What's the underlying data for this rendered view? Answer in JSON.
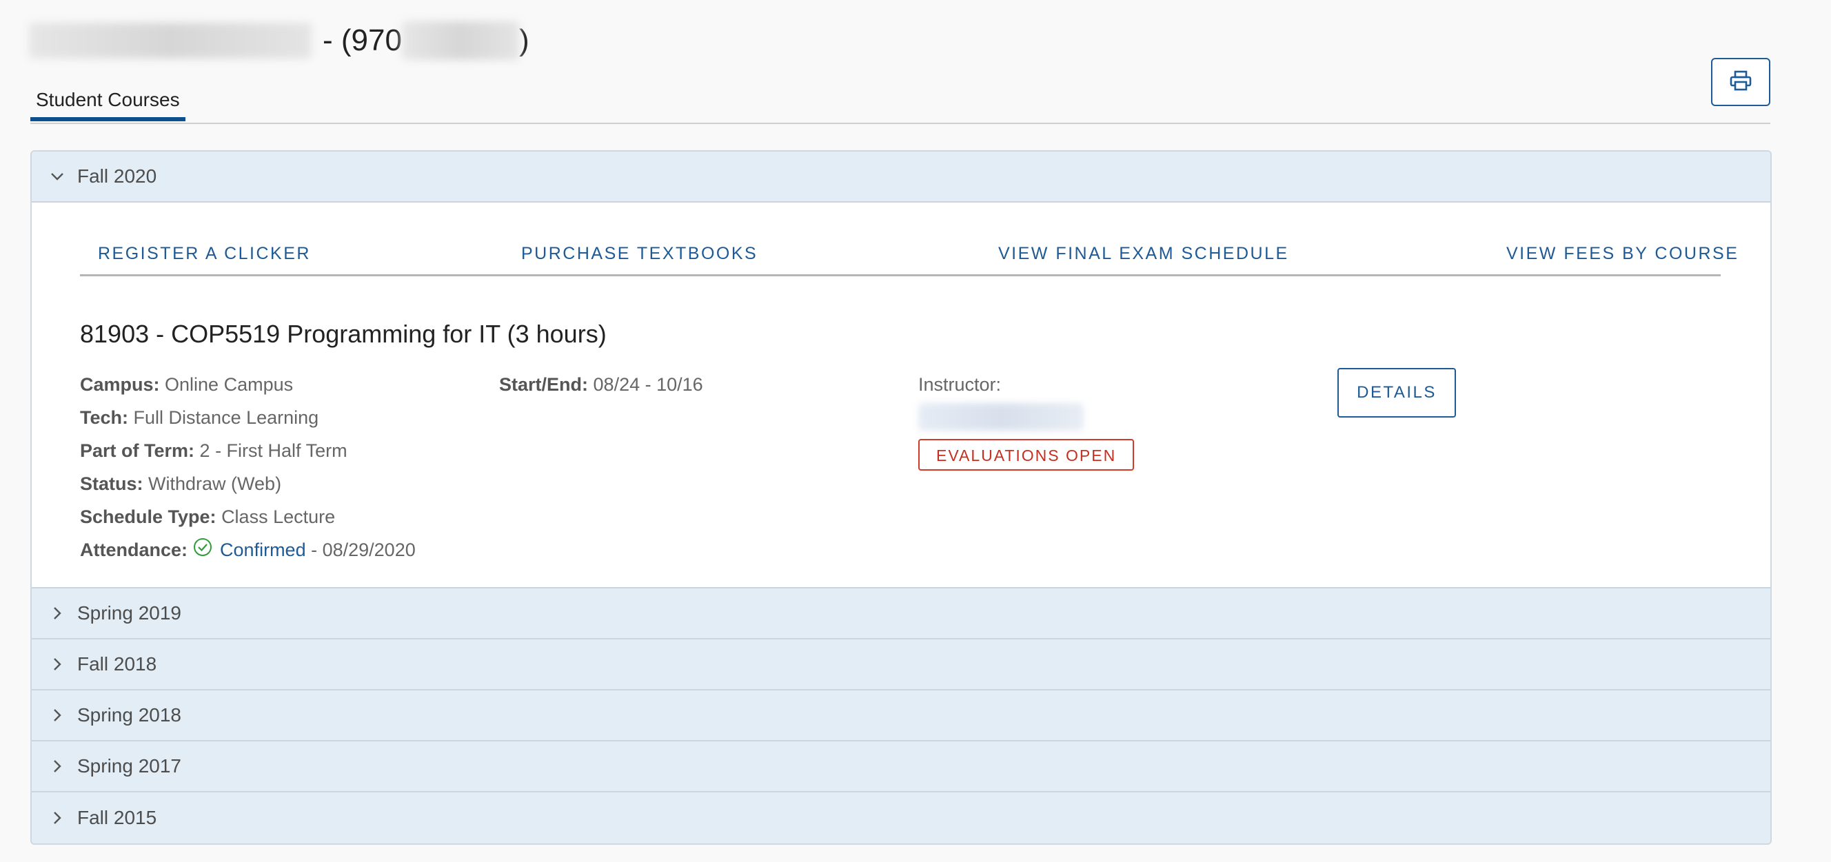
{
  "header": {
    "name_separator": "- (970",
    "id_close": ")"
  },
  "tabs": [
    {
      "label": "Student Courses",
      "active": true
    }
  ],
  "colors": {
    "accent": "#1d5a96",
    "tab_underline": "#0b4f8f",
    "term_header_bg": "#e2edf5",
    "evaluation_red": "#c62f20",
    "confirmed_green": "#2e9e3a"
  },
  "terms": [
    {
      "label": "Fall 2020",
      "expanded": true
    },
    {
      "label": "Spring 2019",
      "expanded": false
    },
    {
      "label": "Fall 2018",
      "expanded": false
    },
    {
      "label": "Spring 2018",
      "expanded": false
    },
    {
      "label": "Spring 2017",
      "expanded": false
    },
    {
      "label": "Fall 2015",
      "expanded": false
    }
  ],
  "term_links": [
    {
      "label": "REGISTER A CLICKER"
    },
    {
      "label": "PURCHASE TEXTBOOKS"
    },
    {
      "label": "VIEW FINAL EXAM SCHEDULE"
    },
    {
      "label": "VIEW FEES BY COURSE"
    }
  ],
  "course": {
    "title": "81903 - COP5519 Programming for IT (3 hours)",
    "campus_label": "Campus:",
    "campus": "Online Campus",
    "tech_label": "Tech:",
    "tech": "Full Distance Learning",
    "part_of_term_label": "Part of Term:",
    "part_of_term": "2 - First Half Term",
    "status_label": "Status:",
    "status": "Withdraw (Web)",
    "schedule_type_label": "Schedule Type:",
    "schedule_type": "Class Lecture",
    "attendance_label": "Attendance:",
    "attendance_status": "Confirmed",
    "attendance_date": "- 08/29/2020",
    "start_end_label": "Start/End:",
    "start_end": "08/24 - 10/16",
    "instructor_label": "Instructor:",
    "evaluations_label": "EVALUATIONS OPEN",
    "details_label": "DETAILS"
  },
  "icons": {
    "print": "printer-icon",
    "expanded": "chevron-down-icon",
    "collapsed": "chevron-right-icon",
    "attendance": "check-circle-icon"
  }
}
